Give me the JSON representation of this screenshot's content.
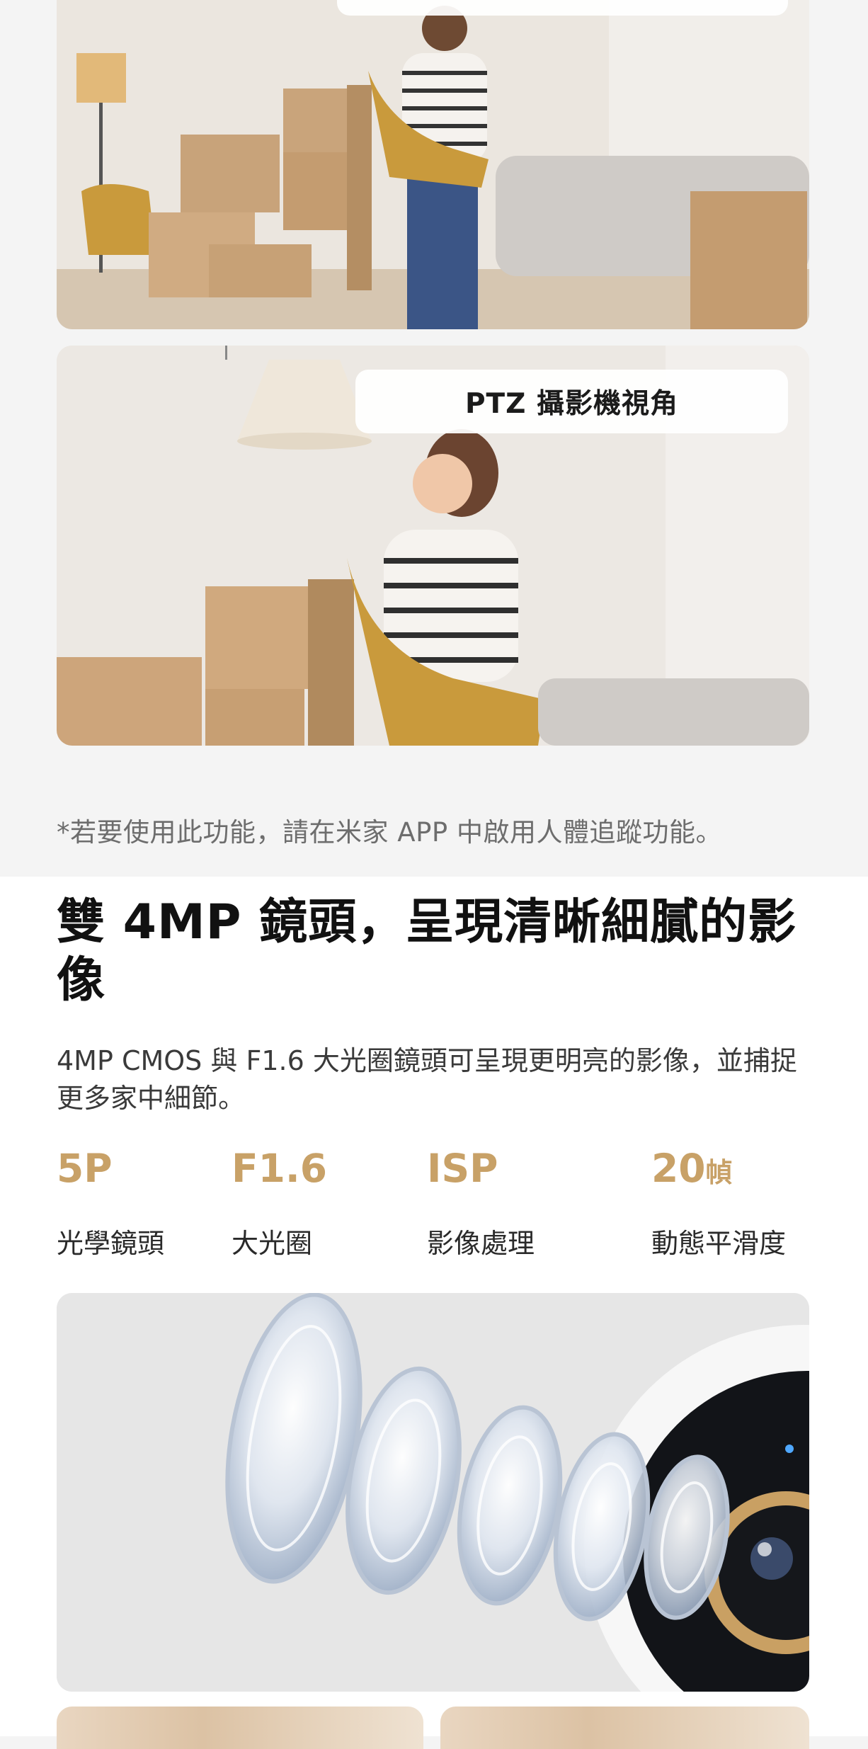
{
  "gallery": {
    "ptz_view_label": "PTZ 攝影機視角",
    "footnote": "*若要使用此功能，請在米家 APP 中啟用人體追蹤功能。"
  },
  "feature": {
    "title": "雙 4MP 鏡頭，呈現清晰細膩的影像",
    "description": "4MP CMOS 與 F1.6 大光圈鏡頭可呈現更明亮的影像，並捕捉更多家中細節。",
    "stats": [
      {
        "value": "5P",
        "unit": "",
        "label": "光學鏡頭"
      },
      {
        "value": "F1.6",
        "unit": "",
        "label": "大光圈"
      },
      {
        "value": "ISP",
        "unit": "",
        "label": "影像處理"
      },
      {
        "value": "20",
        "unit": "幀",
        "label": "動態平滑度"
      }
    ]
  },
  "colors": {
    "accent_gold": "#c8a167",
    "top_background": "#f4f4f4",
    "bottom_background": "#ffffff"
  }
}
